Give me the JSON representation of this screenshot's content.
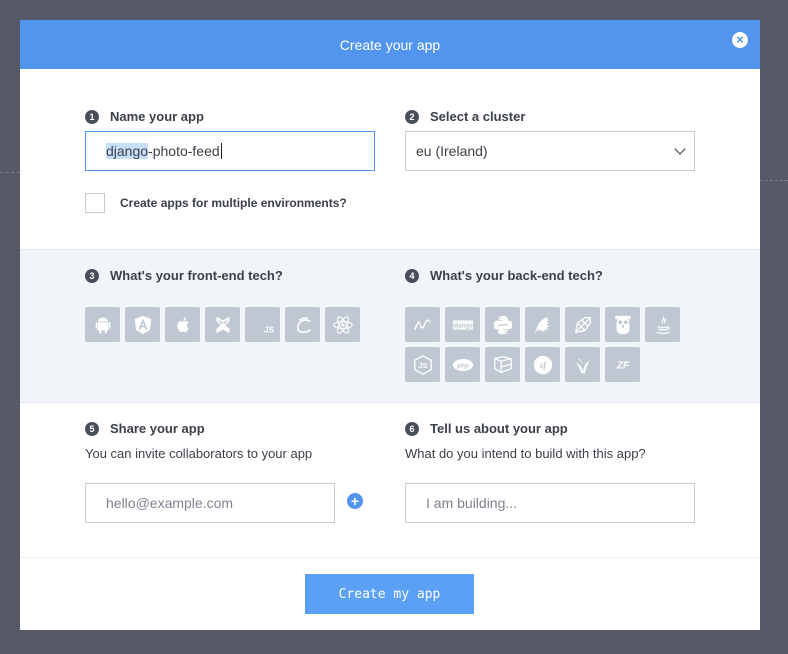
{
  "modal": {
    "title": "Create your app",
    "close_icon": "close-icon"
  },
  "name_app": {
    "step": "1",
    "label": "Name your app",
    "value_selected": "django",
    "value_rest": "-photo-feed"
  },
  "cluster": {
    "step": "2",
    "label": "Select a cluster",
    "selected": "eu (Ireland)"
  },
  "multi_env": {
    "label": "Create apps for multiple environments?",
    "checked": false
  },
  "frontend": {
    "step": "3",
    "label": "What's your front-end tech?",
    "icons": [
      "android-icon",
      "angular-icon",
      "apple-icon",
      "backbone-icon",
      "javascript-icon",
      "ember-icon",
      "react-icon"
    ]
  },
  "backend": {
    "step": "4",
    "label": "What's your back-end tech?",
    "icons": [
      "net-icon",
      "django-icon",
      "python-icon",
      "sinatra-icon",
      "ruby-icon",
      "go-icon",
      "java-icon",
      "nodejs-icon",
      "php-icon",
      "laravel-icon",
      "symfony-icon",
      "yii-icon",
      "zend-icon"
    ],
    "django_text": "django",
    "php_text": "php",
    "js_text": "JS",
    "sf_text": "sf",
    "zf_text": "ZF"
  },
  "share": {
    "step": "5",
    "label": "Share your app",
    "subtext": "You can invite collaborators to your app",
    "placeholder": "hello@example.com"
  },
  "about": {
    "step": "6",
    "label": "Tell us about your app",
    "subtext": "What do you intend to build with this app?",
    "placeholder": "I am building..."
  },
  "submit": {
    "label": "Create my app"
  },
  "colors": {
    "accent": "#5295ee",
    "tile": "#bfc8d2",
    "overlay": "#575a66"
  }
}
